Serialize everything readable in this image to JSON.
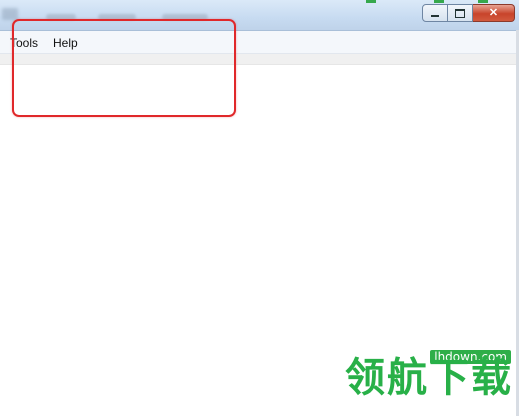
{
  "menu": {
    "items": [
      "Tools",
      "Help"
    ]
  },
  "window_controls": {
    "minimize": "—",
    "maximize": "□",
    "close": "✕"
  },
  "watermark": {
    "url": "lhdown.com",
    "text": "领航下载",
    "color": "#28b048"
  },
  "highlight": {
    "color": "#e0282a"
  }
}
